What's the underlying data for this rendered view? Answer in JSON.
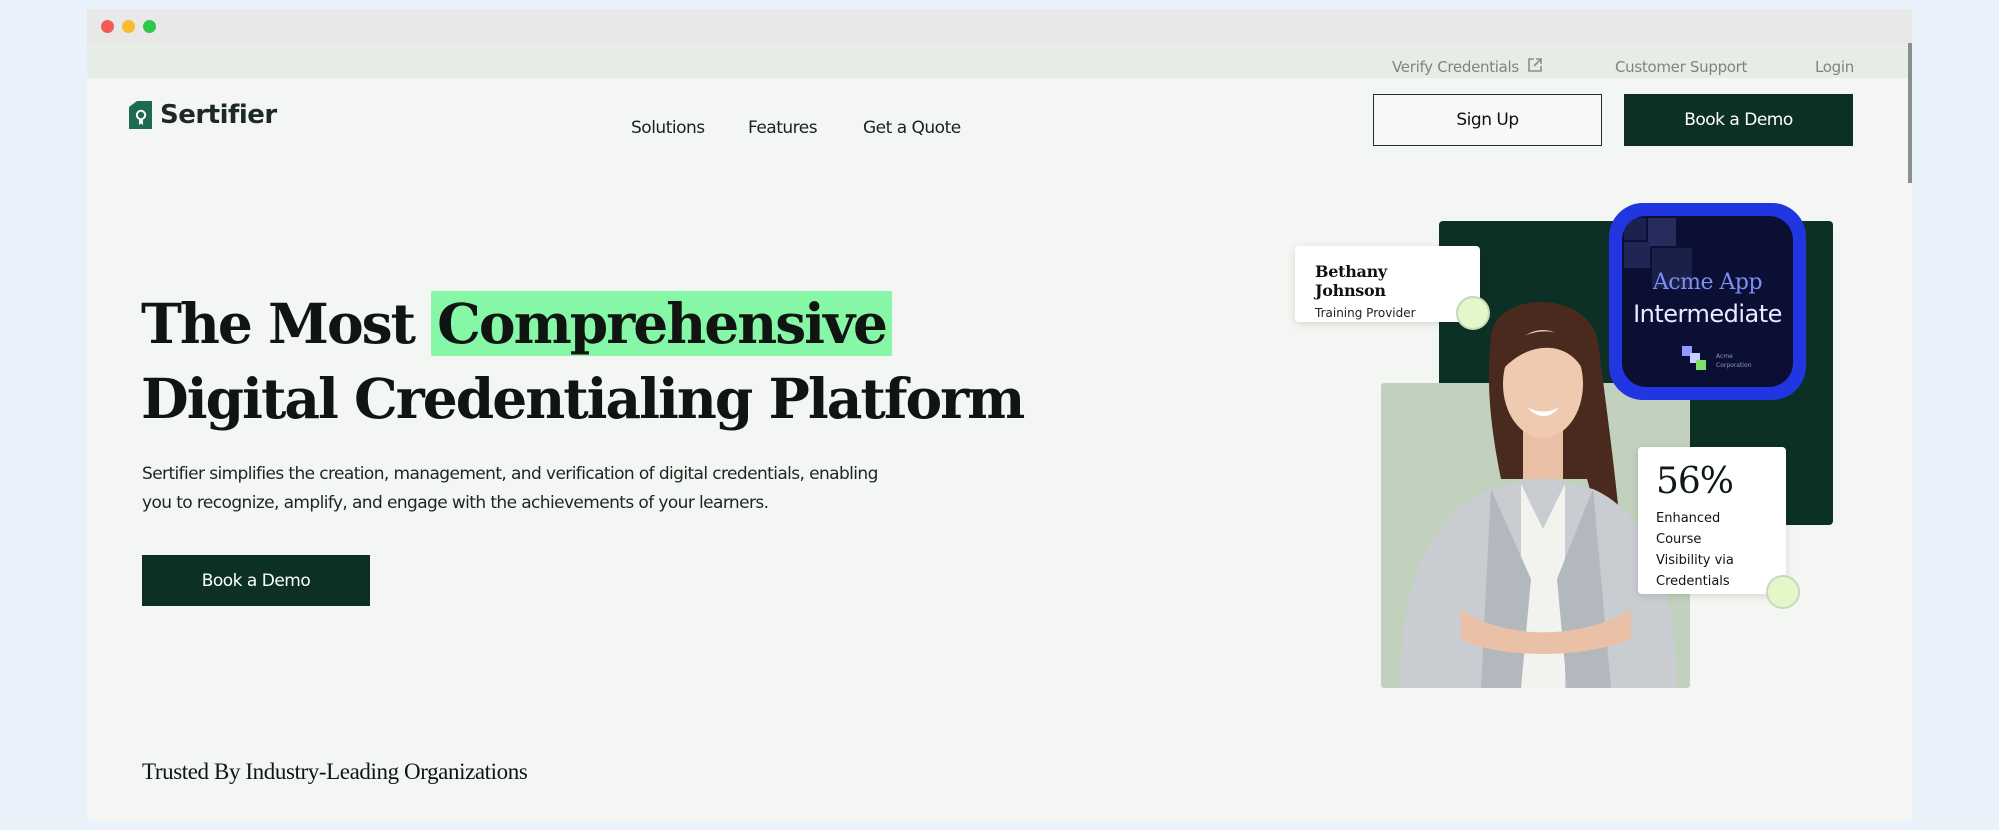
{
  "topbar": {
    "verify_label": "Verify Credentials",
    "support_label": "Customer Support",
    "login_label": "Login"
  },
  "header": {
    "logo_text": "Sertifier",
    "nav": [
      "Solutions",
      "Features",
      "Get a Quote"
    ],
    "signup_label": "Sign Up",
    "demo_label": "Book a Demo"
  },
  "hero": {
    "title_part1": "The Most",
    "title_highlight": "Comprehensive",
    "title_line2": "Digital Credentialing Platform",
    "description": "Sertifier simplifies the creation, management, and verification of digital credentials, enabling you to recognize, amplify, and engage with the achievements of your learners.",
    "cta_label": "Book a Demo"
  },
  "profile_card": {
    "name": "Bethany Johnson",
    "role": "Training Provider"
  },
  "badge": {
    "title": "Acme App",
    "level": "Intermediate",
    "org_line1": "Acme",
    "org_line2": "Corporation"
  },
  "stat_card": {
    "value": "56%",
    "line1": "Enhanced Course",
    "line2": "Visibility via",
    "line3": "Credentials"
  },
  "trusted": {
    "label": "Trusted By Industry-Leading Organizations"
  },
  "colors": {
    "brand_dark": "#0d3026",
    "highlight": "#86f7a7",
    "badge_blue": "#2136e0",
    "page_bg": "#f3f6f2"
  },
  "icons": [
    "external-link-icon",
    "sertifier-logo-icon",
    "acme-logo-icon"
  ]
}
